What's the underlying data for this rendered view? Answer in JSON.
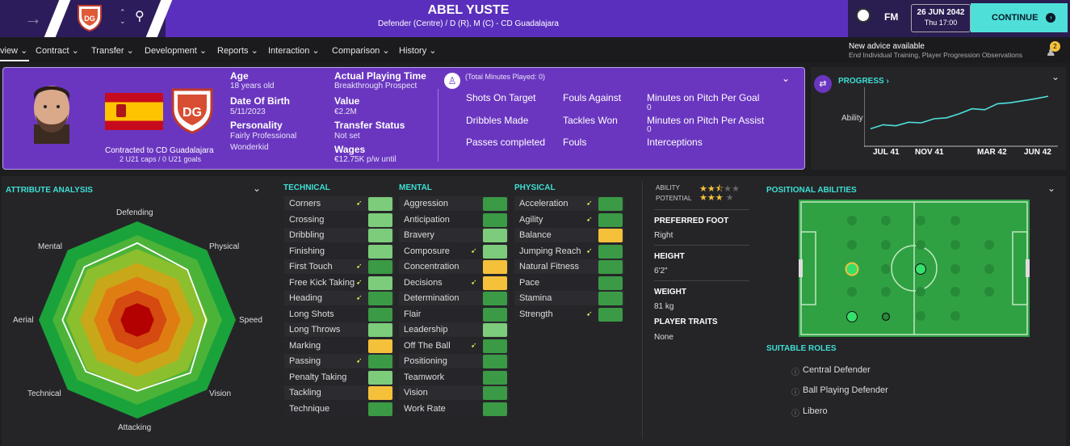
{
  "header": {
    "player_name": "ABEL YUSTE",
    "positions": "Defender (Centre) / D (R), M (C) - CD Guadalajara",
    "date": "26 JUN 2042",
    "time": "Thu 17:00",
    "continue_label": "CONTINUE",
    "fm_label": "FM",
    "advice_title": "New advice available",
    "advice_detail": "End Individual Training, Player Progression Observations",
    "advice_count": "2"
  },
  "nav": [
    "view",
    "Contract",
    "Transfer",
    "Development",
    "Reports",
    "Interaction",
    "Comparison",
    "History"
  ],
  "profile": {
    "contract": "Contracted to CD Guadalajara",
    "caps": "2 U21 caps / 0 U21 goals",
    "age_label": "Age",
    "age": "18 years old",
    "dob_label": "Date Of Birth",
    "dob": "5/11/2023",
    "personality_label": "Personality",
    "personality": "Fairly Professional",
    "media": "Wonderkid",
    "apt_label": "Actual Playing Time",
    "apt": "Breakthrough Prospect",
    "value_label": "Value",
    "value": "€2.2M",
    "transfer_label": "Transfer Status",
    "transfer": "Not set",
    "wages_label": "Wages",
    "wages": "€12.75K p/w until",
    "minutes_played": "(Total Minutes Played: 0)",
    "stats": {
      "col1": [
        "Shots On Target",
        "Dribbles Made",
        "Passes completed"
      ],
      "col2": [
        "Fouls Against",
        "Tackles Won",
        "Fouls"
      ],
      "col3": [
        "Minutes on Pitch Per Goal",
        "Minutes on Pitch Per Assist",
        "Interceptions"
      ],
      "col3_values": [
        "0",
        "0",
        ""
      ]
    }
  },
  "progress": {
    "title": "PROGRESS",
    "ylabel": "Ability",
    "x_labels": [
      "JUL 41",
      "NOV 41",
      "MAR 42",
      "JUN 42"
    ],
    "values": [
      0.3,
      0.38,
      0.36,
      0.43,
      0.42,
      0.5,
      0.52,
      0.6,
      0.7,
      0.68,
      0.8,
      0.82,
      0.86,
      0.9,
      0.95
    ]
  },
  "attribute_analysis": {
    "title": "ATTRIBUTE ANALYSIS",
    "axes": [
      "Defending",
      "Physical",
      "Speed",
      "Vision",
      "Attacking",
      "Technical",
      "Aerial",
      "Mental"
    ],
    "values": [
      0.78,
      0.72,
      0.7,
      0.76,
      0.72,
      0.74,
      0.76,
      0.76
    ]
  },
  "colors": {
    "green_light": "#7ccc7c",
    "green_dark": "#3a9a45",
    "yellow": "#f5c13b",
    "accent": "#3fdfd4",
    "purple": "#6a36c0"
  },
  "technical": {
    "title": "TECHNICAL",
    "items": [
      {
        "name": "Corners",
        "level": "light",
        "flag": true
      },
      {
        "name": "Crossing",
        "level": "light",
        "flag": false
      },
      {
        "name": "Dribbling",
        "level": "light",
        "flag": false
      },
      {
        "name": "Finishing",
        "level": "light",
        "flag": false
      },
      {
        "name": "First Touch",
        "level": "dark",
        "flag": true
      },
      {
        "name": "Free Kick Taking",
        "level": "light",
        "flag": true
      },
      {
        "name": "Heading",
        "level": "dark",
        "flag": true
      },
      {
        "name": "Long Shots",
        "level": "dark",
        "flag": false
      },
      {
        "name": "Long Throws",
        "level": "light",
        "flag": false
      },
      {
        "name": "Marking",
        "level": "yellow",
        "flag": false
      },
      {
        "name": "Passing",
        "level": "dark",
        "flag": true
      },
      {
        "name": "Penalty Taking",
        "level": "light",
        "flag": false
      },
      {
        "name": "Tackling",
        "level": "yellow",
        "flag": false
      },
      {
        "name": "Technique",
        "level": "dark",
        "flag": false
      }
    ]
  },
  "mental": {
    "title": "MENTAL",
    "items": [
      {
        "name": "Aggression",
        "level": "dark",
        "flag": false
      },
      {
        "name": "Anticipation",
        "level": "dark",
        "flag": false
      },
      {
        "name": "Bravery",
        "level": "light",
        "flag": false
      },
      {
        "name": "Composure",
        "level": "light",
        "flag": true
      },
      {
        "name": "Concentration",
        "level": "yellow",
        "flag": false
      },
      {
        "name": "Decisions",
        "level": "yellow",
        "flag": true
      },
      {
        "name": "Determination",
        "level": "dark",
        "flag": false
      },
      {
        "name": "Flair",
        "level": "dark",
        "flag": false
      },
      {
        "name": "Leadership",
        "level": "light",
        "flag": false
      },
      {
        "name": "Off The Ball",
        "level": "dark",
        "flag": true
      },
      {
        "name": "Positioning",
        "level": "dark",
        "flag": false
      },
      {
        "name": "Teamwork",
        "level": "dark",
        "flag": false
      },
      {
        "name": "Vision",
        "level": "dark",
        "flag": false
      },
      {
        "name": "Work Rate",
        "level": "dark",
        "flag": false
      }
    ]
  },
  "physical": {
    "title": "PHYSICAL",
    "items": [
      {
        "name": "Acceleration",
        "level": "dark",
        "flag": true
      },
      {
        "name": "Agility",
        "level": "dark",
        "flag": true
      },
      {
        "name": "Balance",
        "level": "yellow",
        "flag": false
      },
      {
        "name": "Jumping Reach",
        "level": "dark",
        "flag": true
      },
      {
        "name": "Natural Fitness",
        "level": "dark",
        "flag": false
      },
      {
        "name": "Pace",
        "level": "dark",
        "flag": false
      },
      {
        "name": "Stamina",
        "level": "dark",
        "flag": false
      },
      {
        "name": "Strength",
        "level": "dark",
        "flag": true
      }
    ]
  },
  "info": {
    "ability_label": "ABILITY",
    "ability_stars": 2.5,
    "potential_label": "POTENTIAL",
    "potential_stars": 3,
    "foot_label": "PREFERRED FOOT",
    "foot": "Right",
    "height_label": "HEIGHT",
    "height": "6'2\"",
    "weight_label": "WEIGHT",
    "weight": "81 kg",
    "traits_label": "PLAYER TRAITS",
    "traits": "None"
  },
  "positional": {
    "title": "POSITIONAL ABILITIES",
    "roles_title": "SUITABLE ROLES",
    "roles": [
      "Central Defender",
      "Ball Playing Defender",
      "Libero"
    ]
  }
}
